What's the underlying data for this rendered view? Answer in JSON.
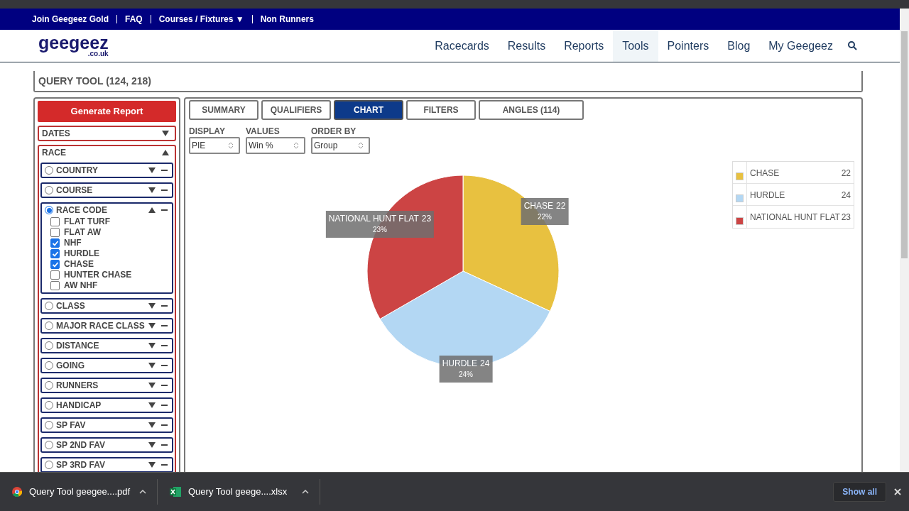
{
  "top_links": [
    "Join Geegeez Gold",
    "FAQ",
    "Courses / Fixtures ▼",
    "Non Runners"
  ],
  "logo": {
    "name": "geegeez",
    "suffix": ".co.uk"
  },
  "nav": [
    {
      "label": "Racecards",
      "selected": false
    },
    {
      "label": "Results",
      "selected": false
    },
    {
      "label": "Reports",
      "selected": false
    },
    {
      "label": "Tools",
      "selected": true
    },
    {
      "label": "Pointers",
      "selected": false
    },
    {
      "label": "Blog",
      "selected": false
    },
    {
      "label": "My Geegeez",
      "selected": false
    }
  ],
  "page_title": "QUERY TOOL (124, 218)",
  "generate_button": "Generate Report",
  "sections": [
    {
      "label": "DATES",
      "expanded": false
    },
    {
      "label": "RACE",
      "expanded": true,
      "filters": [
        {
          "label": "COUNTRY",
          "selected": false,
          "expanded": false
        },
        {
          "label": "COURSE",
          "selected": false,
          "expanded": false
        },
        {
          "label": "RACE CODE",
          "selected": true,
          "expanded": true,
          "options": [
            {
              "label": "FLAT TURF",
              "checked": false
            },
            {
              "label": "FLAT AW",
              "checked": false
            },
            {
              "label": "NHF",
              "checked": true
            },
            {
              "label": "HURDLE",
              "checked": true
            },
            {
              "label": "CHASE",
              "checked": true
            },
            {
              "label": "HUNTER CHASE",
              "checked": false
            },
            {
              "label": "AW NHF",
              "checked": false
            }
          ]
        },
        {
          "label": "CLASS",
          "selected": false,
          "expanded": false
        },
        {
          "label": "MAJOR RACE CLASS",
          "selected": false,
          "expanded": false
        },
        {
          "label": "DISTANCE",
          "selected": false,
          "expanded": false
        },
        {
          "label": "GOING",
          "selected": false,
          "expanded": false
        },
        {
          "label": "RUNNERS",
          "selected": false,
          "expanded": false
        },
        {
          "label": "HANDICAP",
          "selected": false,
          "expanded": false
        },
        {
          "label": "SP FAV",
          "selected": false,
          "expanded": false
        },
        {
          "label": "SP 2ND FAV",
          "selected": false,
          "expanded": false
        },
        {
          "label": "SP 3RD FAV",
          "selected": false,
          "expanded": false
        }
      ]
    }
  ],
  "tabs": [
    {
      "label": "SUMMARY",
      "selected": false
    },
    {
      "label": "QUALIFIERS",
      "selected": false
    },
    {
      "label": "CHART",
      "selected": true
    },
    {
      "label": "FILTERS",
      "selected": false
    },
    {
      "label": "ANGLES (114)",
      "selected": false
    }
  ],
  "controls": [
    {
      "label": "DISPLAY",
      "value": "PIE"
    },
    {
      "label": "VALUES",
      "value": "Win %"
    },
    {
      "label": "ORDER BY",
      "value": "Group"
    }
  ],
  "chart": {
    "chart_data": {
      "type": "pie",
      "categories": [
        "CHASE",
        "HURDLE",
        "NATIONAL HUNT FLAT"
      ],
      "values": [
        22,
        24,
        23
      ],
      "data_labels": true
    },
    "slice_labels": [
      {
        "percent": "22%"
      },
      {
        "percent": "24%"
      },
      {
        "percent": "23%"
      }
    ],
    "legend": [
      {
        "label": "CHASE",
        "value": "22",
        "color": "#e8c140"
      },
      {
        "label": "HURDLE",
        "value": "24",
        "color": "#b3d7f3"
      },
      {
        "label": "NATIONAL HUNT FLAT",
        "value": "23",
        "color": "#cc4444"
      }
    ]
  },
  "downloads": [
    {
      "kind": "pdf",
      "name": "Query Tool geegee....pdf"
    },
    {
      "kind": "xlsx",
      "name": "Query Tool geege....xlsx"
    }
  ],
  "show_all": "Show all"
}
